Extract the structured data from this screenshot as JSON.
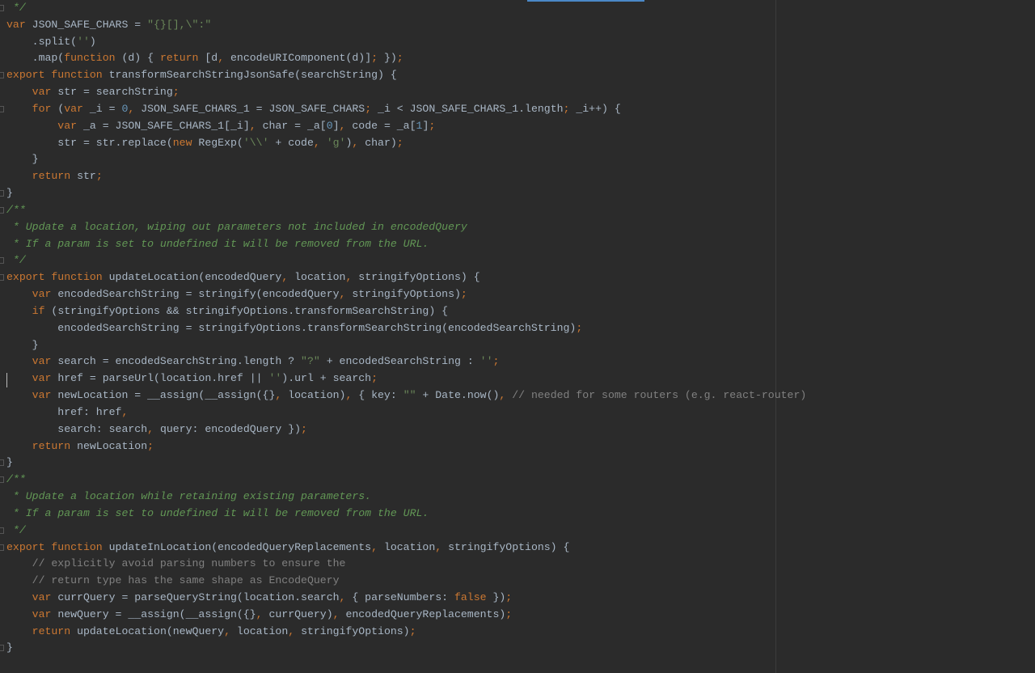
{
  "editor": {
    "colors": {
      "background": "#2b2b2b",
      "keyword": "#cc7832",
      "text": "#a9b7c6",
      "string": "#6a8759",
      "number": "#6897bb",
      "comment": "#808080",
      "doc_comment": "#629755"
    },
    "lines": [
      [
        [
          "d",
          " */"
        ]
      ],
      [
        [
          "k",
          "var "
        ],
        [
          "t",
          "JSON_SAFE_CHARS = "
        ],
        [
          "s",
          "\"{}[],\\\":\""
        ]
      ],
      [
        [
          "t",
          "    .split("
        ],
        [
          "s",
          "''"
        ],
        [
          "t",
          ")"
        ]
      ],
      [
        [
          "t",
          "    .map("
        ],
        [
          "k",
          "function "
        ],
        [
          "t",
          "(d) { "
        ],
        [
          "k",
          "return "
        ],
        [
          "t",
          "[d"
        ],
        [
          "p",
          ", "
        ],
        [
          "t",
          "encodeURIComponent(d)]"
        ],
        [
          "p",
          "; "
        ],
        [
          "t",
          "})"
        ],
        [
          "p",
          ";"
        ]
      ],
      [
        [
          "k",
          "export function "
        ],
        [
          "t",
          "transformSearchStringJsonSafe(searchString) {"
        ]
      ],
      [
        [
          "k",
          "    var "
        ],
        [
          "t",
          "str = searchString"
        ],
        [
          "p",
          ";"
        ]
      ],
      [
        [
          "k",
          "    for "
        ],
        [
          "t",
          "("
        ],
        [
          "k",
          "var "
        ],
        [
          "t",
          "_i = "
        ],
        [
          "n",
          "0"
        ],
        [
          "p",
          ", "
        ],
        [
          "t",
          "JSON_SAFE_CHARS_1 = JSON_SAFE_CHARS"
        ],
        [
          "p",
          "; "
        ],
        [
          "t",
          "_i < JSON_SAFE_CHARS_1.length"
        ],
        [
          "p",
          "; "
        ],
        [
          "t",
          "_i++) {"
        ]
      ],
      [
        [
          "k",
          "        var "
        ],
        [
          "t",
          "_a = JSON_SAFE_CHARS_1[_i]"
        ],
        [
          "p",
          ", "
        ],
        [
          "t",
          "char = _a["
        ],
        [
          "n",
          "0"
        ],
        [
          "t",
          "]"
        ],
        [
          "p",
          ", "
        ],
        [
          "t",
          "code = _a["
        ],
        [
          "n",
          "1"
        ],
        [
          "t",
          "]"
        ],
        [
          "p",
          ";"
        ]
      ],
      [
        [
          "t",
          "        str = str.replace("
        ],
        [
          "k",
          "new "
        ],
        [
          "t",
          "RegExp("
        ],
        [
          "s",
          "'\\\\'"
        ],
        [
          "t",
          " + code"
        ],
        [
          "p",
          ", "
        ],
        [
          "s",
          "'g'"
        ],
        [
          "t",
          ")"
        ],
        [
          "p",
          ", "
        ],
        [
          "t",
          "char)"
        ],
        [
          "p",
          ";"
        ]
      ],
      [
        [
          "t",
          "    }"
        ]
      ],
      [
        [
          "k",
          "    return "
        ],
        [
          "t",
          "str"
        ],
        [
          "p",
          ";"
        ]
      ],
      [
        [
          "t",
          "}"
        ]
      ],
      [
        [
          "d",
          "/**"
        ]
      ],
      [
        [
          "d",
          " * Update a location, wiping out parameters not included in encodedQuery"
        ]
      ],
      [
        [
          "d",
          " * If a param is set to undefined it will be removed from the URL."
        ]
      ],
      [
        [
          "d",
          " */"
        ]
      ],
      [
        [
          "k",
          "export function "
        ],
        [
          "t",
          "updateLocation(encodedQuery"
        ],
        [
          "p",
          ", "
        ],
        [
          "t",
          "location"
        ],
        [
          "p",
          ", "
        ],
        [
          "t",
          "stringifyOptions) {"
        ]
      ],
      [
        [
          "k",
          "    var "
        ],
        [
          "t",
          "encodedSearchString = stringify(encodedQuery"
        ],
        [
          "p",
          ", "
        ],
        [
          "t",
          "stringifyOptions)"
        ],
        [
          "p",
          ";"
        ]
      ],
      [
        [
          "k",
          "    if "
        ],
        [
          "t",
          "(stringifyOptions && stringifyOptions.transformSearchString) {"
        ]
      ],
      [
        [
          "t",
          "        encodedSearchString = stringifyOptions.transformSearchString(encodedSearchString)"
        ],
        [
          "p",
          ";"
        ]
      ],
      [
        [
          "t",
          "    }"
        ]
      ],
      [
        [
          "k",
          "    var "
        ],
        [
          "t",
          "search = encodedSearchString.length ? "
        ],
        [
          "s",
          "\"?\""
        ],
        [
          "t",
          " + encodedSearchString : "
        ],
        [
          "s",
          "''"
        ],
        [
          "p",
          ";"
        ]
      ],
      [
        [
          "k",
          "    var "
        ],
        [
          "t",
          "href = parseUrl(location.href || "
        ],
        [
          "s",
          "''"
        ],
        [
          "t",
          ").url + search"
        ],
        [
          "p",
          ";"
        ]
      ],
      [
        [
          "k",
          "    var "
        ],
        [
          "t",
          "newLocation = __assign(__assign({}"
        ],
        [
          "p",
          ", "
        ],
        [
          "t",
          "location)"
        ],
        [
          "p",
          ", "
        ],
        [
          "t",
          "{ key: "
        ],
        [
          "s",
          "\"\""
        ],
        [
          "t",
          " + Date.now()"
        ],
        [
          "p",
          ", "
        ],
        [
          "c",
          "// needed for some routers (e.g. react-router)"
        ]
      ],
      [
        [
          "t",
          "        href: href"
        ],
        [
          "p",
          ","
        ]
      ],
      [
        [
          "t",
          "        search: search"
        ],
        [
          "p",
          ", "
        ],
        [
          "t",
          "query: encodedQuery })"
        ],
        [
          "p",
          ";"
        ]
      ],
      [
        [
          "k",
          "    return "
        ],
        [
          "t",
          "newLocation"
        ],
        [
          "p",
          ";"
        ]
      ],
      [
        [
          "t",
          "}"
        ]
      ],
      [
        [
          "d",
          "/**"
        ]
      ],
      [
        [
          "d",
          " * Update a location while retaining existing parameters."
        ]
      ],
      [
        [
          "d",
          " * If a param is set to undefined it will be removed from the URL."
        ]
      ],
      [
        [
          "d",
          " */"
        ]
      ],
      [
        [
          "k",
          "export function "
        ],
        [
          "t",
          "updateInLocation(encodedQueryReplacements"
        ],
        [
          "p",
          ", "
        ],
        [
          "t",
          "location"
        ],
        [
          "p",
          ", "
        ],
        [
          "t",
          "stringifyOptions) {"
        ]
      ],
      [
        [
          "c",
          "    // explicitly avoid parsing numbers to ensure the"
        ]
      ],
      [
        [
          "c",
          "    // return type has the same shape as EncodeQuery"
        ]
      ],
      [
        [
          "k",
          "    var "
        ],
        [
          "t",
          "currQuery = parseQueryString(location.search"
        ],
        [
          "p",
          ", "
        ],
        [
          "t",
          "{ parseNumbers: "
        ],
        [
          "k",
          "false "
        ],
        [
          "t",
          "})"
        ],
        [
          "p",
          ";"
        ]
      ],
      [
        [
          "k",
          "    var "
        ],
        [
          "t",
          "newQuery = __assign(__assign({}"
        ],
        [
          "p",
          ", "
        ],
        [
          "t",
          "currQuery)"
        ],
        [
          "p",
          ", "
        ],
        [
          "t",
          "encodedQueryReplacements)"
        ],
        [
          "p",
          ";"
        ]
      ],
      [
        [
          "k",
          "    return "
        ],
        [
          "t",
          "updateLocation(newQuery"
        ],
        [
          "p",
          ", "
        ],
        [
          "t",
          "location"
        ],
        [
          "p",
          ", "
        ],
        [
          "t",
          "stringifyOptions)"
        ],
        [
          "p",
          ";"
        ]
      ],
      [
        [
          "t",
          "}"
        ]
      ]
    ]
  }
}
